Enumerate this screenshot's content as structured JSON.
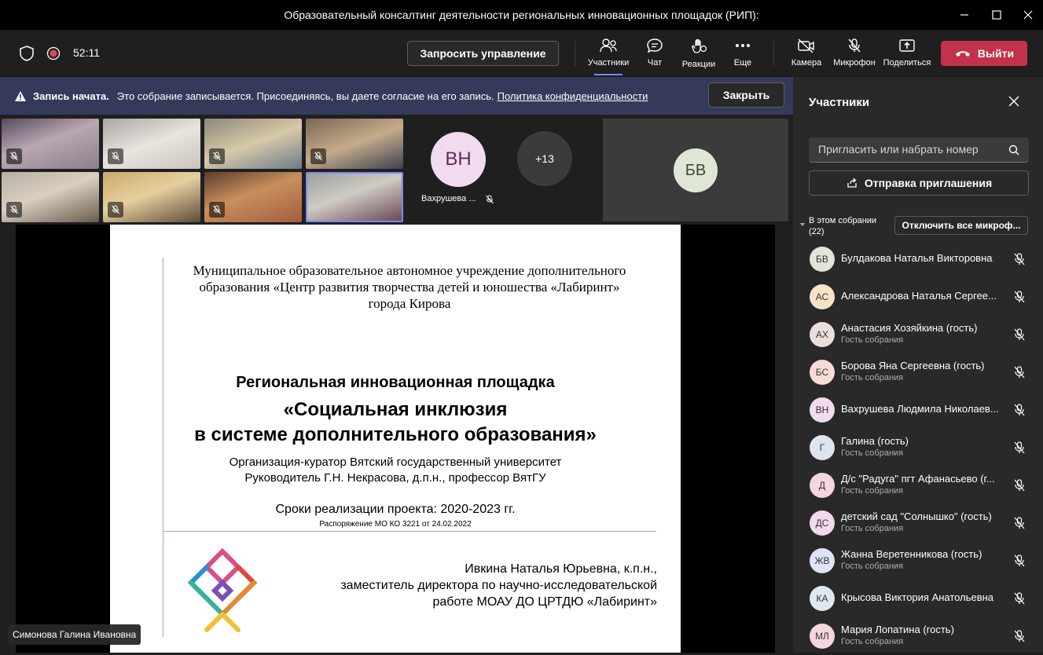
{
  "window": {
    "title": "Образовательный консалтинг деятельности региональных инновационных площадок (РИП):"
  },
  "toolbar": {
    "timer": "52:11",
    "request_control": "Запросить управление",
    "participants": "Участники",
    "chat": "Чат",
    "reactions": "Реакции",
    "more": "Еще",
    "camera": "Камера",
    "mic": "Микрофон",
    "share": "Поделиться",
    "leave": "Выйти"
  },
  "banner": {
    "title": "Запись начата.",
    "text": "Это собрание записывается. Присоединяясь, вы даете согласие на его запись.",
    "link": "Политика конфиденциальности",
    "close": "Закрыть"
  },
  "stage": {
    "vh_initials": "ВН",
    "vh_name": "Вахрушева ...",
    "overflow": "+13",
    "bv_initials": "БВ",
    "presenter": "Симонова Галина Ивановна"
  },
  "slide": {
    "org_line1": "Муниципальное образовательное автономное учреждение дополнительного",
    "org_line2": "образования «Центр развития творчества детей и юношества «Лабиринт»",
    "org_line3": "города Кирова",
    "title1": "Региональная инновационная площадка",
    "title2": "«Социальная инклюзия",
    "title3": "в системе дополнительного образования»",
    "curator": "Организация-куратор Вятский государственный университет",
    "head": "Руководитель  Г.Н. Некрасова, д.п.н., профессор ВятГУ",
    "term": "Сроки реализации проекта: 2020-2023 гг.",
    "order": "Распоряжение МО КО 3221 от 24.02.2022",
    "author1": "Ивкина Наталья Юрьевна, к.п.н.,",
    "author2": "заместитель директора по научно-исследовательской",
    "author3": "работе МОАУ ДО ЦРТДЮ «Лабиринт»"
  },
  "panel": {
    "title": "Участники",
    "search_placeholder": "Пригласить или набрать номер",
    "invite": "Отправка приглашения",
    "in_meeting": "В этом собрании",
    "count": "(22)",
    "mute_all": "Отключить все микроф..."
  },
  "participants": [
    {
      "initials": "БВ",
      "name": "Булдакова Наталья Викторовна",
      "sub": "",
      "color": "#e0e6d6"
    },
    {
      "initials": "АС",
      "name": "Александрова Наталья Сергее...",
      "sub": "",
      "color": "#f7e3c6"
    },
    {
      "initials": "АХ",
      "name": "Анастасия Хозяйкина (гость)",
      "sub": "Гость собрания",
      "color": "#eadfdb"
    },
    {
      "initials": "БС",
      "name": "Борова Яна Сергеевна (гость)",
      "sub": "Гость собрания",
      "color": "#f7dcd6"
    },
    {
      "initials": "ВН",
      "name": "Вахрушева Людмила Николаев...",
      "sub": "",
      "color": "#f2dbee"
    },
    {
      "initials": "Г",
      "name": "Галина (гость)",
      "sub": "Гость собрания",
      "color": "#dde5ef"
    },
    {
      "initials": "Д",
      "name": "Д/с \"Радуга\" пгт Афанасьево (г...",
      "sub": "Гость собрания",
      "color": "#f5d6dc"
    },
    {
      "initials": "ДС",
      "name": "детский сад \"Солнышко\" (гость)",
      "sub": "Гость собрания",
      "color": "#f2d9ec"
    },
    {
      "initials": "ЖВ",
      "name": "Жанна Веретенникова (гость)",
      "sub": "Гость собрания",
      "color": "#dce4f5"
    },
    {
      "initials": "КА",
      "name": "Крысова Виктория Анатольевна",
      "sub": "",
      "color": "#dfe8ee"
    },
    {
      "initials": "МЛ",
      "name": "Мария Лопатина (гость)",
      "sub": "Гость собрания",
      "color": "#f4d7dc"
    }
  ]
}
